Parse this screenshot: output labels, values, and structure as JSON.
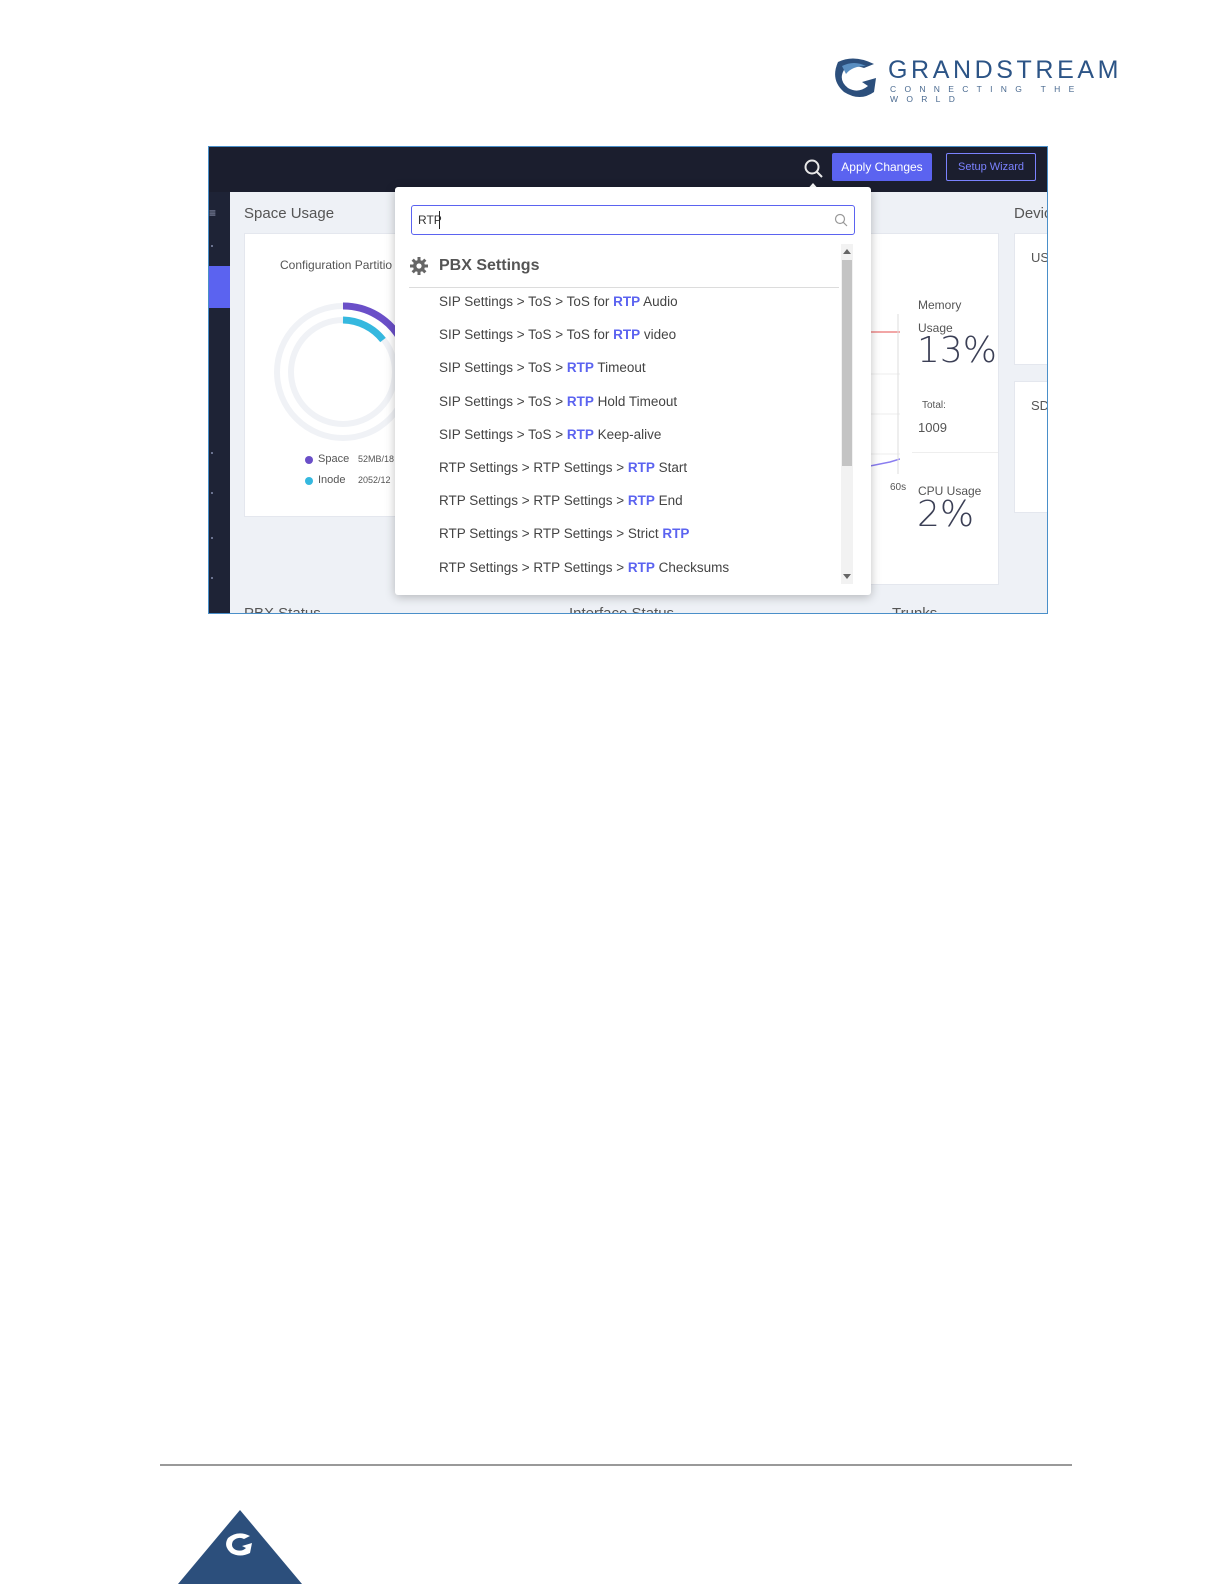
{
  "brand": {
    "name": "GRANDSTREAM",
    "tagline": "CONNECTING THE WORLD"
  },
  "topbar": {
    "apply_label": "Apply Changes",
    "wizard_label": "Setup Wizard",
    "icons": [
      "search-icon"
    ]
  },
  "dashboard": {
    "space_usage_title": "Space Usage",
    "config_partition": "Configuration Partitio",
    "legend_space": "Space",
    "legend_space_value": "52MB/18",
    "legend_inode": "Inode",
    "legend_inode_value": "2052/12",
    "memory_label": "Memory",
    "memory_usage_label": "Usage",
    "memory_pct": "13%",
    "total_label": "Total:",
    "total_value": "1009",
    "axis_60s": "60s",
    "cpu_label": "CPU Usage",
    "cpu_pct": "2%",
    "device_title": "Devic",
    "usb_label": "US",
    "sd_label": "SD",
    "pbx_status": "PBX Status",
    "interface_status": "Interface Status",
    "trunks": "Trunks",
    "colors": {
      "space": "#6a4fc8",
      "inode": "#35b8df",
      "accent": "#5b63f0"
    }
  },
  "search": {
    "query": "RTP",
    "section_title": "PBX Settings",
    "results": [
      {
        "before": "SIP Settings > ToS > ToS for ",
        "match": "RTP",
        "after": " Audio"
      },
      {
        "before": "SIP Settings > ToS > ToS for ",
        "match": "RTP",
        "after": " video"
      },
      {
        "before": "SIP Settings > ToS > ",
        "match": "RTP",
        "after": " Timeout"
      },
      {
        "before": "SIP Settings > ToS > ",
        "match": "RTP",
        "after": " Hold Timeout"
      },
      {
        "before": "SIP Settings > ToS > ",
        "match": "RTP",
        "after": " Keep-alive"
      },
      {
        "before": "RTP Settings > RTP Settings > ",
        "match": "RTP",
        "after": " Start"
      },
      {
        "before": "RTP Settings > RTP Settings > ",
        "match": "RTP",
        "after": " End"
      },
      {
        "before": "RTP Settings > RTP Settings > Strict ",
        "match": "RTP",
        "after": ""
      },
      {
        "before": "RTP Settings > RTP Settings > ",
        "match": "RTP",
        "after": " Checksums"
      }
    ]
  }
}
